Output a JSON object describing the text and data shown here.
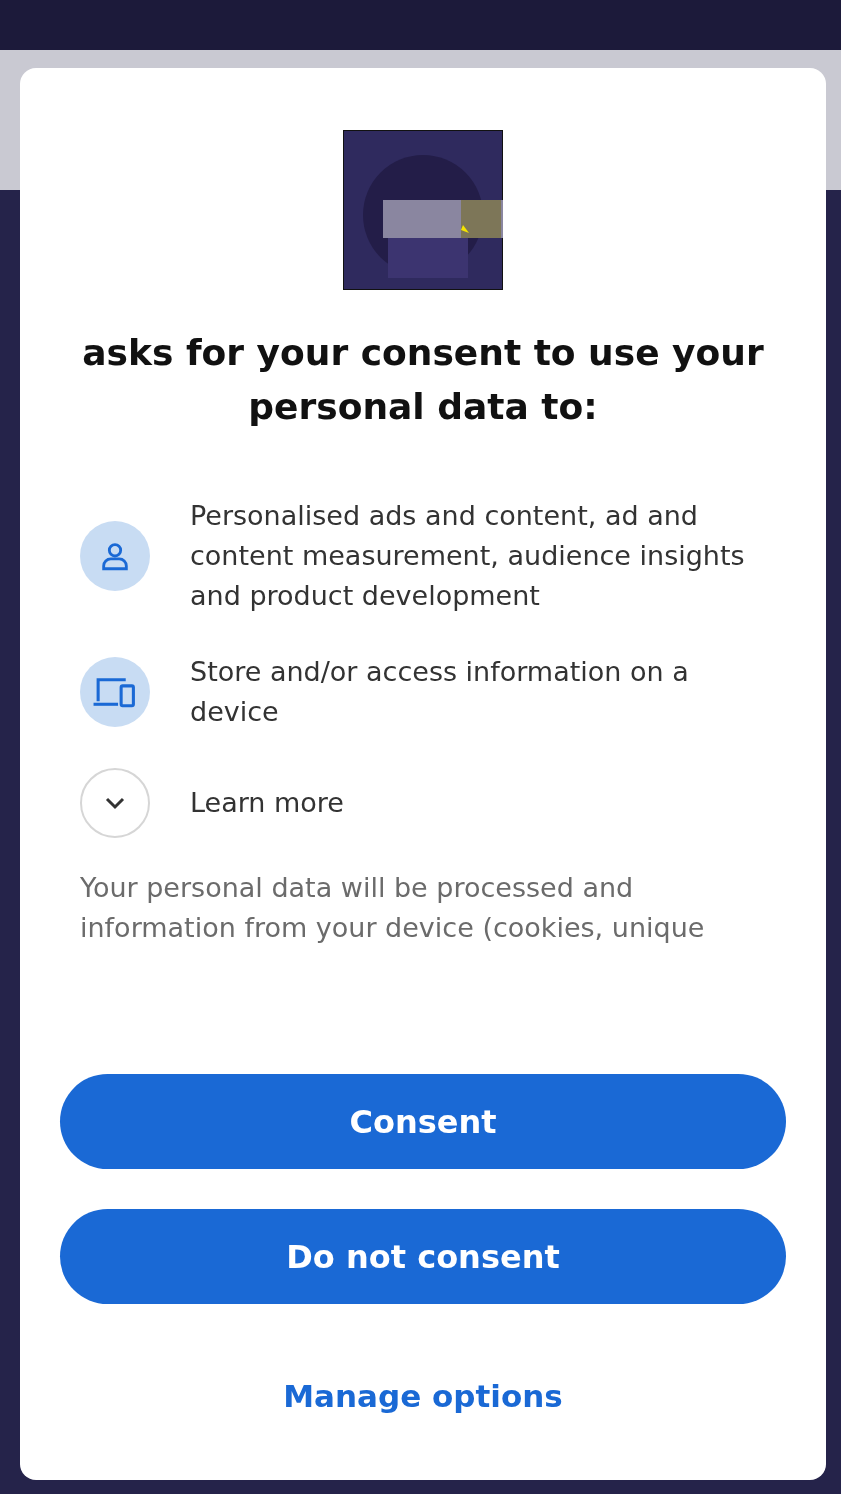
{
  "title": "asks for your consent to use your personal data to:",
  "purposes": [
    {
      "kind": "person",
      "text": "Personalised ads and content, ad and content measurement, audience insights and product development"
    },
    {
      "kind": "devices",
      "text": "Store and/or access information on a device"
    },
    {
      "kind": "expand",
      "text": "Learn more",
      "expanded": false
    }
  ],
  "description": "Your personal data will be processed and information from your device (cookies, unique",
  "buttons": [
    {
      "kind": "primary",
      "label": "Consent"
    },
    {
      "kind": "primary",
      "label": "Do not consent"
    },
    {
      "kind": "link",
      "label": "Manage options"
    }
  ]
}
